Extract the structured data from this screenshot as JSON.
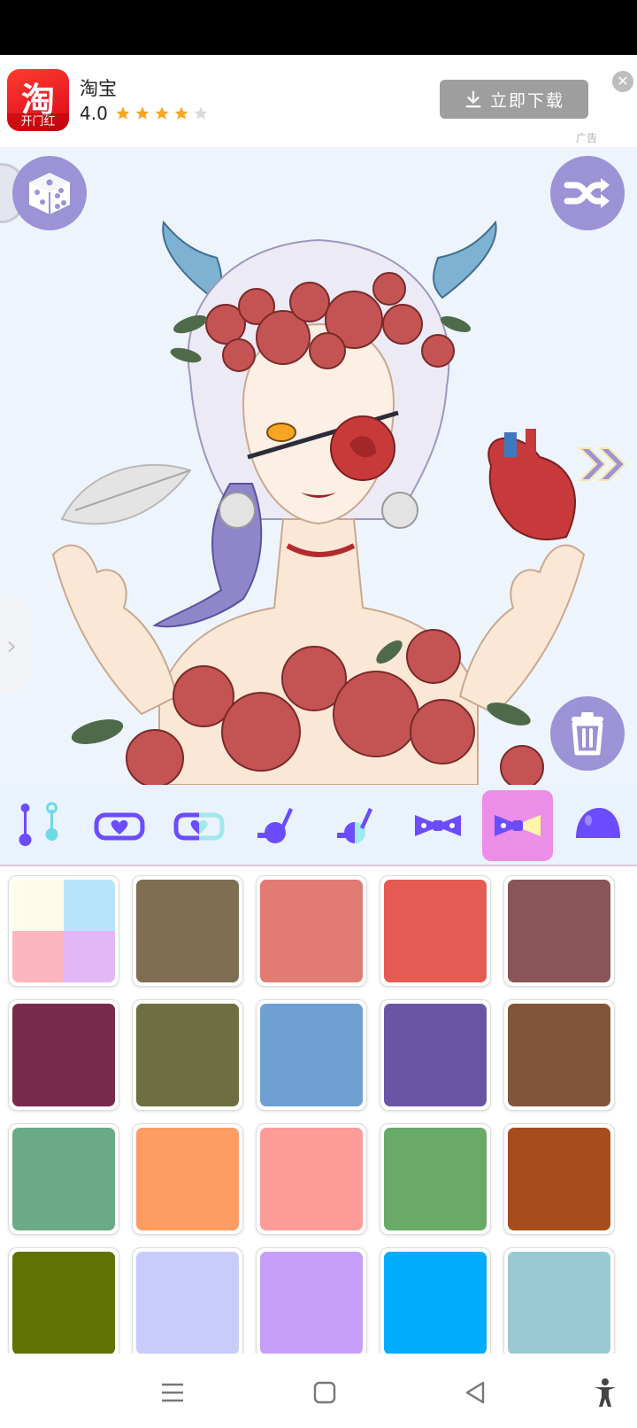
{
  "ad": {
    "app_icon": "taobao-logo",
    "logo_glyph": "淘",
    "logo_caption": "开门红",
    "app_name": "淘宝",
    "rating": "4.0",
    "stars_filled": 4,
    "stars_total": 5,
    "download_label": "立即下载",
    "download_icon": "download-icon",
    "close_icon": "close-icon",
    "ad_tag": "广告"
  },
  "canvas": {
    "background": "#eef4fb",
    "buttons": {
      "random": "dice-icon",
      "shuffle": "shuffle-icon",
      "delete": "trash-icon",
      "next": "double-chevron-right-icon",
      "side_tab": "chevron-right-icon"
    },
    "character": "avatar-illustration"
  },
  "toolbar": {
    "items": [
      {
        "name": "earring-chain-icon"
      },
      {
        "name": "heart-badge-icon"
      },
      {
        "name": "half-badge-icon"
      },
      {
        "name": "pendant-icon"
      },
      {
        "name": "half-pendant-icon"
      },
      {
        "name": "bow-icon"
      },
      {
        "name": "bow-highlight-icon",
        "selected": true
      },
      {
        "name": "blob-icon"
      }
    ],
    "accent": "#6c4cff",
    "selected_color": "#ec8de8"
  },
  "palette": {
    "multicolor": [
      "#fffbe9",
      "#b7e3fb",
      "#fcb6bd",
      "#e3b6f6"
    ],
    "colors": [
      "#7f6e53",
      "#e27b74",
      "#e55a53",
      "#895556",
      "#782a4b",
      "#6e6f41",
      "#6ea0d2",
      "#6a55a5",
      "#82553b",
      "#6aaa86",
      "#fd9d63",
      "#fc9b98",
      "#69aa67",
      "#a74d1c",
      "#607201",
      "#c8ccfb",
      "#c69ef8",
      "#01acfd",
      "#9ac9d3"
    ]
  },
  "navbar": {
    "menu": "menu-icon",
    "home": "home-icon",
    "back": "back-icon",
    "accessibility": "accessibility-icon"
  }
}
